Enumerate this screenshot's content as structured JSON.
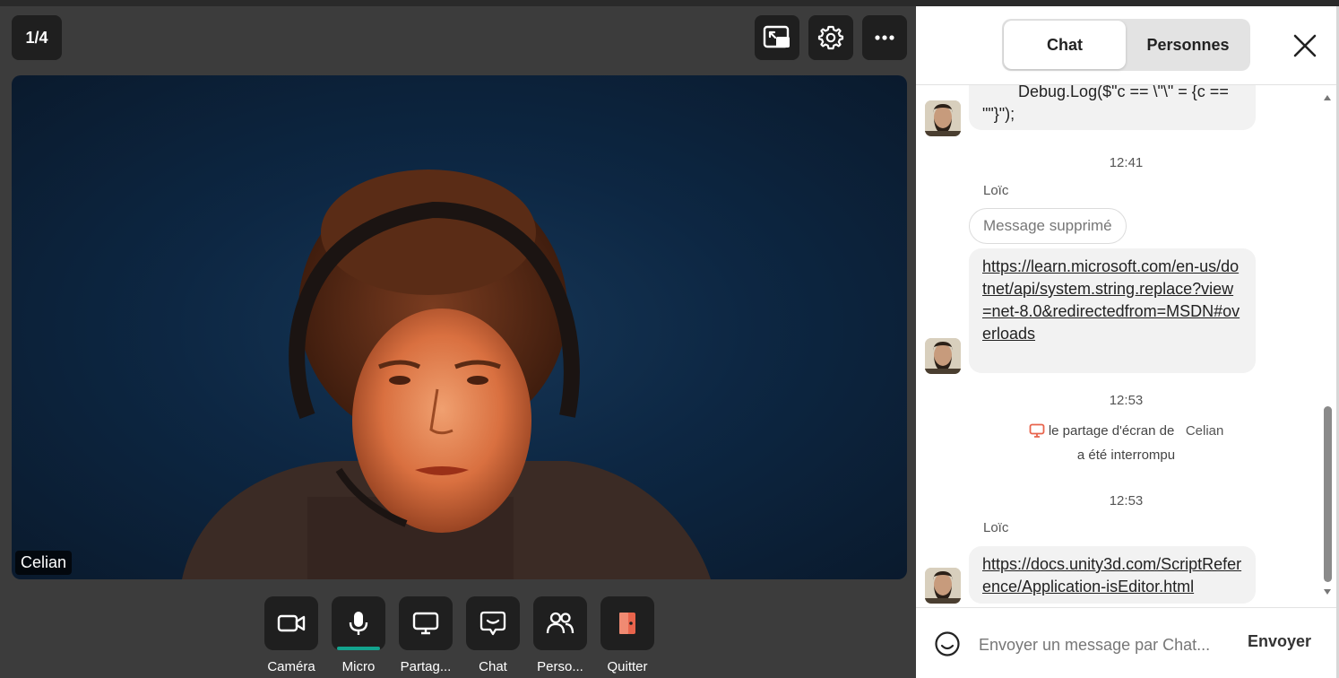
{
  "meeting": {
    "page_indicator": "1/4",
    "top_buttons": [
      {
        "name": "picture-in-picture-icon"
      },
      {
        "name": "gear-icon"
      },
      {
        "name": "more-icon"
      }
    ],
    "participant_name": "Celian",
    "controls": [
      {
        "label": "Caméra",
        "icon": "camera-icon"
      },
      {
        "label": "Micro",
        "icon": "microphone-icon",
        "active": true
      },
      {
        "label": "Partag...",
        "icon": "screen-share-icon"
      },
      {
        "label": "Chat",
        "icon": "chat-icon"
      },
      {
        "label": "Perso...",
        "icon": "people-icon"
      },
      {
        "label": "Quitter",
        "icon": "leave-door-icon"
      }
    ],
    "accent_color": "#13a38e",
    "leave_color": "#e8644c"
  },
  "panel": {
    "tabs": {
      "chat": "Chat",
      "people": "Personnes"
    },
    "messages": {
      "code_line_1": "Debug.Log($\"c == \\\"\\\" = {c ==",
      "code_line_2": "\"\"}\");",
      "time_1": "12:41",
      "sender_1": "Loïc",
      "deleted": "Message supprimé",
      "link_1": "https://learn.microsoft.com/en-us/dotnet/api/system.string.replace?view=net-8.0&redirectedfrom=MSDN#overloads",
      "time_2": "12:53",
      "system_prefix": "le partage d'écran de",
      "system_name": "Celian",
      "system_suffix": "a été interrompu",
      "time_3": "12:53",
      "sender_2": "Loïc",
      "link_2": "https://docs.unity3d.com/ScriptReference/Application-isEditor.html"
    },
    "composer": {
      "placeholder": "Envoyer un message par Chat...",
      "send_label": "Envoyer"
    }
  }
}
